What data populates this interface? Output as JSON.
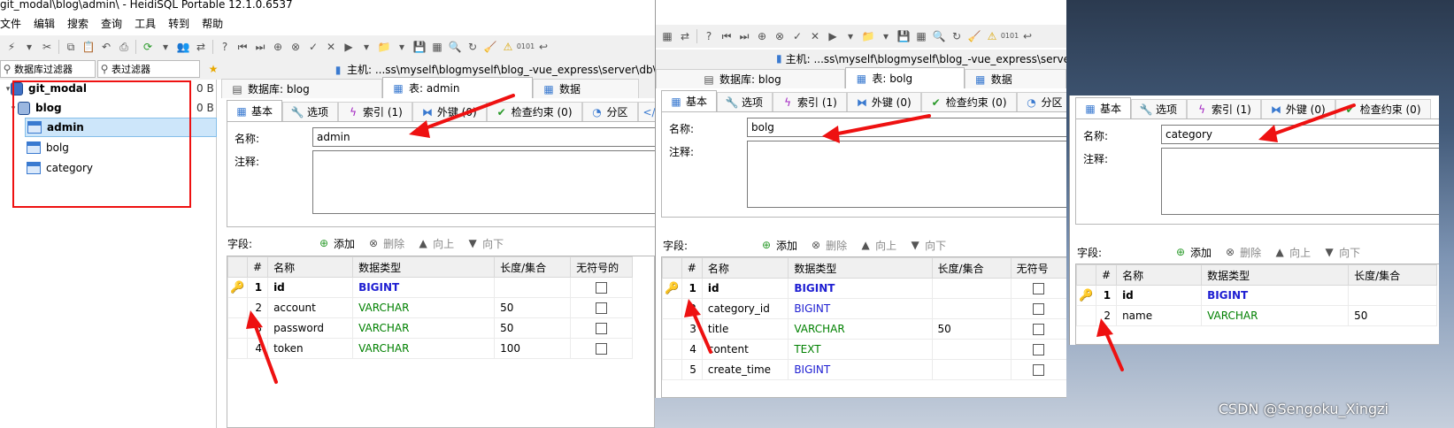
{
  "title": "git_modal\\blog\\admin\\ - HeidiSQL Portable 12.1.0.6537",
  "menu": [
    "文件",
    "编辑",
    "搜索",
    "查询",
    "工具",
    "转到",
    "帮助"
  ],
  "filters": {
    "db_filter": "数据库过滤器",
    "table_filter": "表过滤器"
  },
  "host_path_1": "主机: ...ss\\myself\\blogmyself\\blog_-vue_express\\server\\db\\",
  "host_path_2": "主机: ...ss\\myself\\blogmyself\\blog_-vue_express\\server",
  "tree": {
    "root": {
      "label": "git_modal",
      "size": "0 B"
    },
    "db": {
      "label": "blog",
      "size": "0 B"
    },
    "tables": [
      "admin",
      "bolg",
      "category"
    ]
  },
  "db_tab": "数据库: blog",
  "data_tab": "数据",
  "data_tab_2": "数据",
  "subtabs": {
    "basic": "基本",
    "options": "选项",
    "index": "索引 (1)",
    "fk": "外键 (0)",
    "check": "检查约束 (0)",
    "partition": "分区",
    "cre": "CR"
  },
  "labels": {
    "name": "名称:",
    "comment": "注释:",
    "fields": "字段:"
  },
  "actions": {
    "add": "添加",
    "delete": "删除",
    "up": "向上",
    "down": "向下"
  },
  "columns": {
    "num": "#",
    "name": "名称",
    "type": "数据类型",
    "length": "长度/集合",
    "unsigned": "无符号的",
    "unsigned_cut": "无符号"
  },
  "win1": {
    "table_tab": "表: admin",
    "table_name": "admin",
    "rows": [
      {
        "n": "1",
        "name": "id",
        "type": "BIGINT",
        "len": "",
        "key": true
      },
      {
        "n": "2",
        "name": "account",
        "type": "VARCHAR",
        "len": "50"
      },
      {
        "n": "3",
        "name": "password",
        "type": "VARCHAR",
        "len": "50"
      },
      {
        "n": "4",
        "name": "token",
        "type": "VARCHAR",
        "len": "100"
      }
    ]
  },
  "win2": {
    "table_tab": "表: bolg",
    "table_name": "bolg",
    "rows": [
      {
        "n": "1",
        "name": "id",
        "type": "BIGINT",
        "len": "",
        "key": true
      },
      {
        "n": "2",
        "name": "category_id",
        "type": "BIGINT",
        "len": ""
      },
      {
        "n": "3",
        "name": "title",
        "type": "VARCHAR",
        "len": "50"
      },
      {
        "n": "4",
        "name": "content",
        "type": "TEXT",
        "len": ""
      },
      {
        "n": "5",
        "name": "create_time",
        "type": "BIGINT",
        "len": ""
      }
    ]
  },
  "win3": {
    "table_name": "category",
    "rows": [
      {
        "n": "1",
        "name": "id",
        "type": "BIGINT",
        "len": "",
        "key": true
      },
      {
        "n": "2",
        "name": "name",
        "type": "VARCHAR",
        "len": "50"
      }
    ]
  },
  "watermark": "CSDN @Sengoku_Xingzi",
  "colors": {
    "accent_red": "#e11111",
    "bigint": "#1e1ed2",
    "varchar": "#008000",
    "selection": "#cde6fa"
  }
}
